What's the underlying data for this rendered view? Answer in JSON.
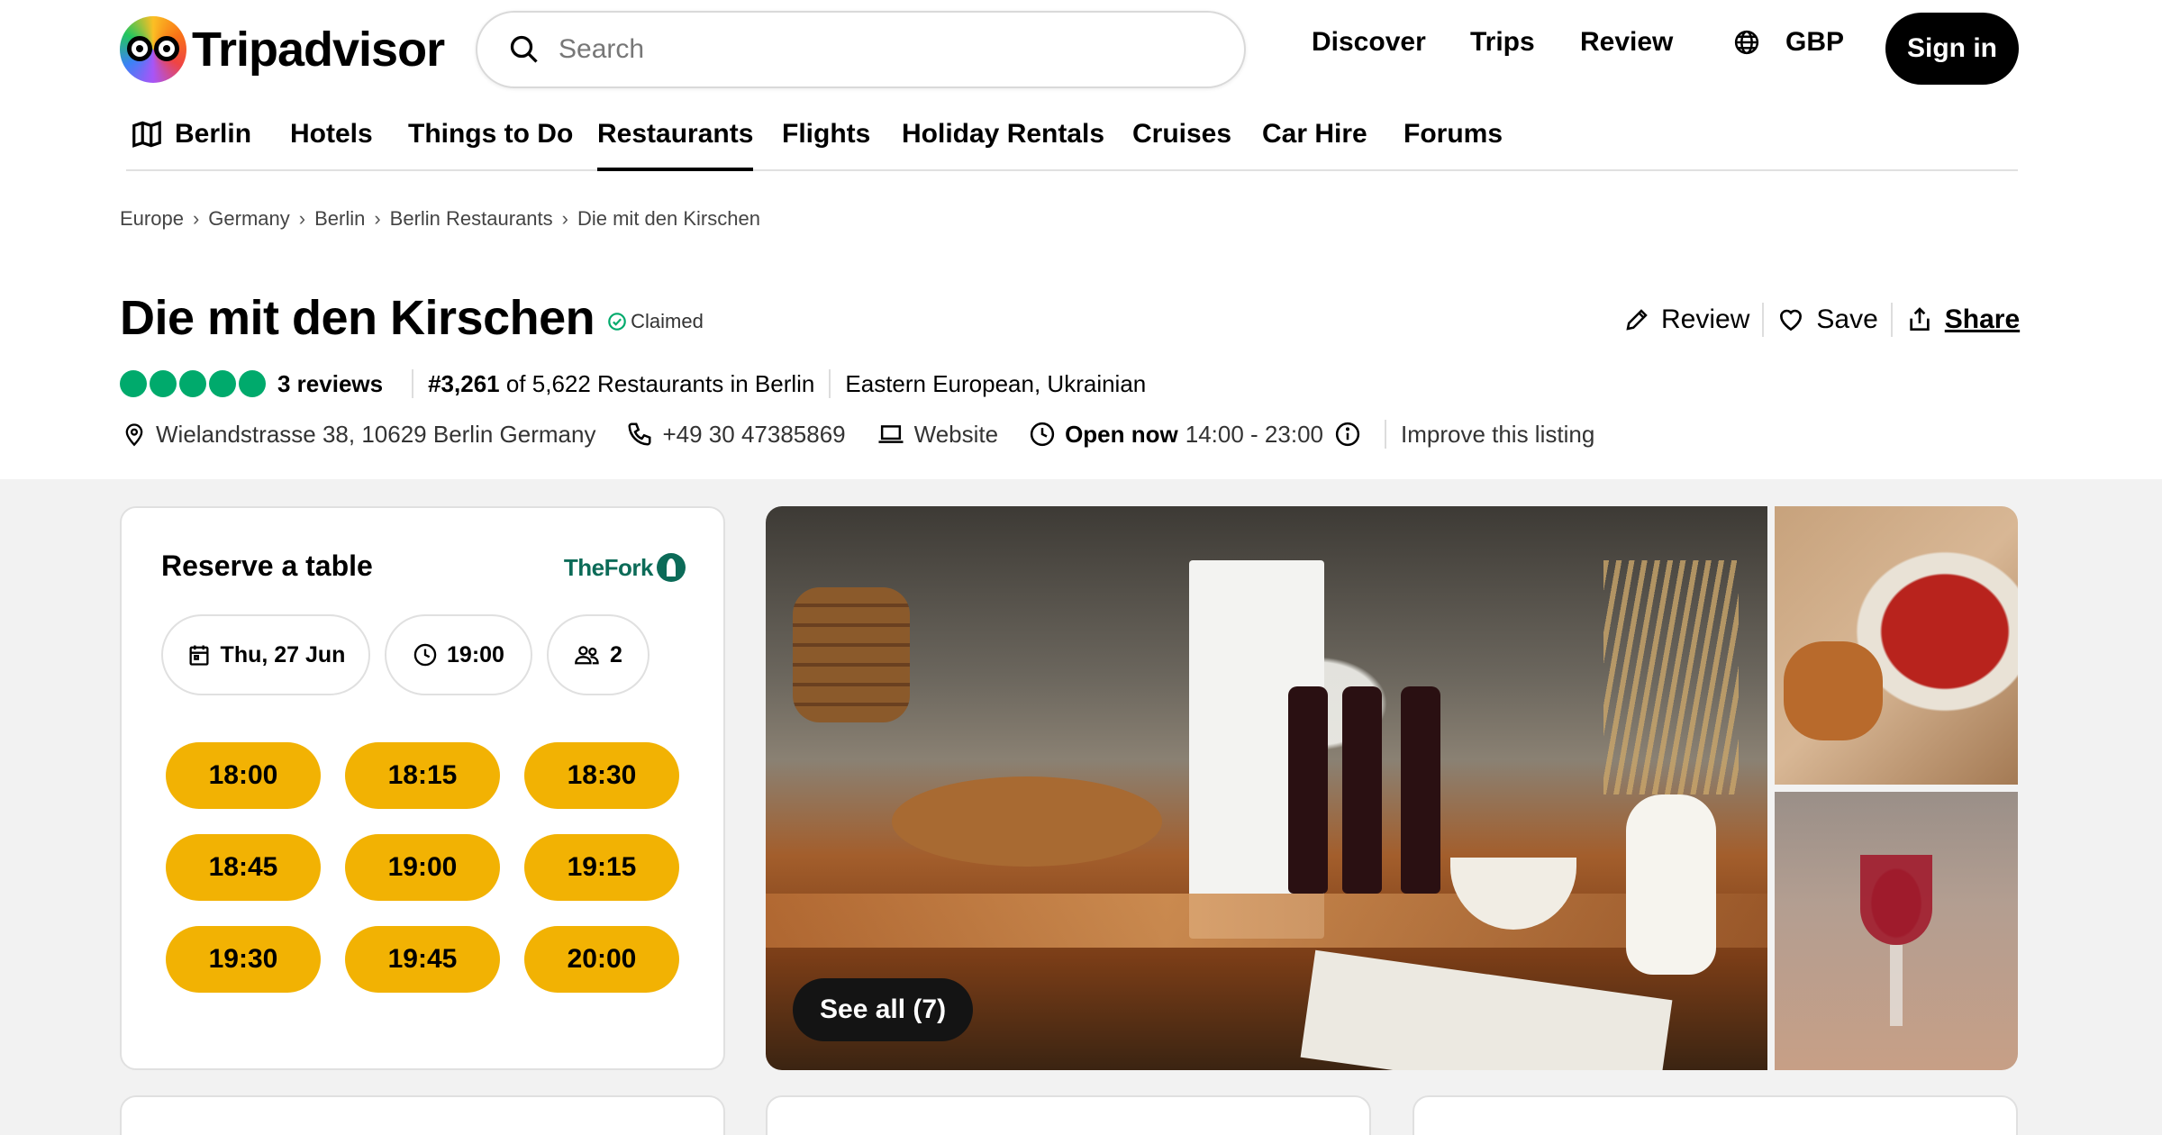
{
  "header": {
    "brand": "Tripadvisor",
    "search_placeholder": "Search",
    "nav": {
      "discover": "Discover",
      "trips": "Trips",
      "review": "Review"
    },
    "currency": "GBP",
    "sign_in": "Sign in"
  },
  "subnav": {
    "location": "Berlin",
    "items": [
      "Hotels",
      "Things to Do",
      "Restaurants",
      "Flights",
      "Holiday Rentals",
      "Cruises",
      "Car Hire",
      "Forums"
    ],
    "active": "Restaurants"
  },
  "breadcrumb": [
    "Europe",
    "Germany",
    "Berlin",
    "Berlin Restaurants",
    "Die mit den Kirschen"
  ],
  "restaurant": {
    "name": "Die mit den Kirschen",
    "claimed": "Claimed",
    "rating_bubbles": 5,
    "reviews": "3 reviews",
    "rank_number": "#3,261",
    "rank_rest": " of 5,622 Restaurants in Berlin",
    "cuisines": "Eastern European, Ukrainian",
    "address": "Wielandstrasse 38, 10629 Berlin Germany",
    "phone": "+49 30 47385869",
    "website": "Website",
    "open_status": "Open now",
    "hours": "14:00 - 23:00",
    "improve": "Improve this listing"
  },
  "actions": {
    "review": "Review",
    "save": "Save",
    "share": "Share"
  },
  "reservation": {
    "title": "Reserve a table",
    "partner": "TheFork",
    "date": "Thu, 27 Jun",
    "time": "19:00",
    "guests": "2",
    "slots": [
      "18:00",
      "18:15",
      "18:30",
      "18:45",
      "19:00",
      "19:15",
      "19:30",
      "19:45",
      "20:00"
    ]
  },
  "gallery": {
    "see_all": "See all (7)"
  },
  "colors": {
    "rating_green": "#00aa6c",
    "slot_yellow": "#f2b203",
    "thefork_green": "#0c6b58"
  }
}
